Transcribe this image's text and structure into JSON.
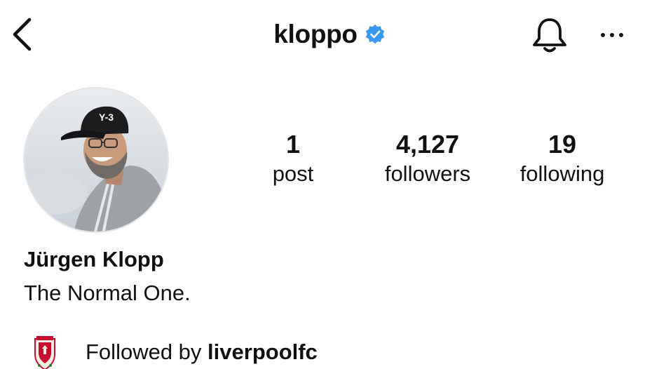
{
  "header": {
    "username": "kloppo",
    "verified": true,
    "back_icon": "chevron-left-icon",
    "bell_icon": "bell-icon",
    "more_icon": "more-horizontal-icon",
    "verified_color": "#3897f0"
  },
  "profile": {
    "full_name": "Jürgen Klopp",
    "bio": "The Normal One."
  },
  "stats": {
    "posts": {
      "count": "1",
      "label": "post"
    },
    "followers": {
      "count": "4,127",
      "label": "followers"
    },
    "following": {
      "count": "19",
      "label": "following"
    }
  },
  "followed_by": {
    "prefix": "Followed by",
    "account": "liverpoolfc",
    "badge": "liverpool-crest"
  }
}
